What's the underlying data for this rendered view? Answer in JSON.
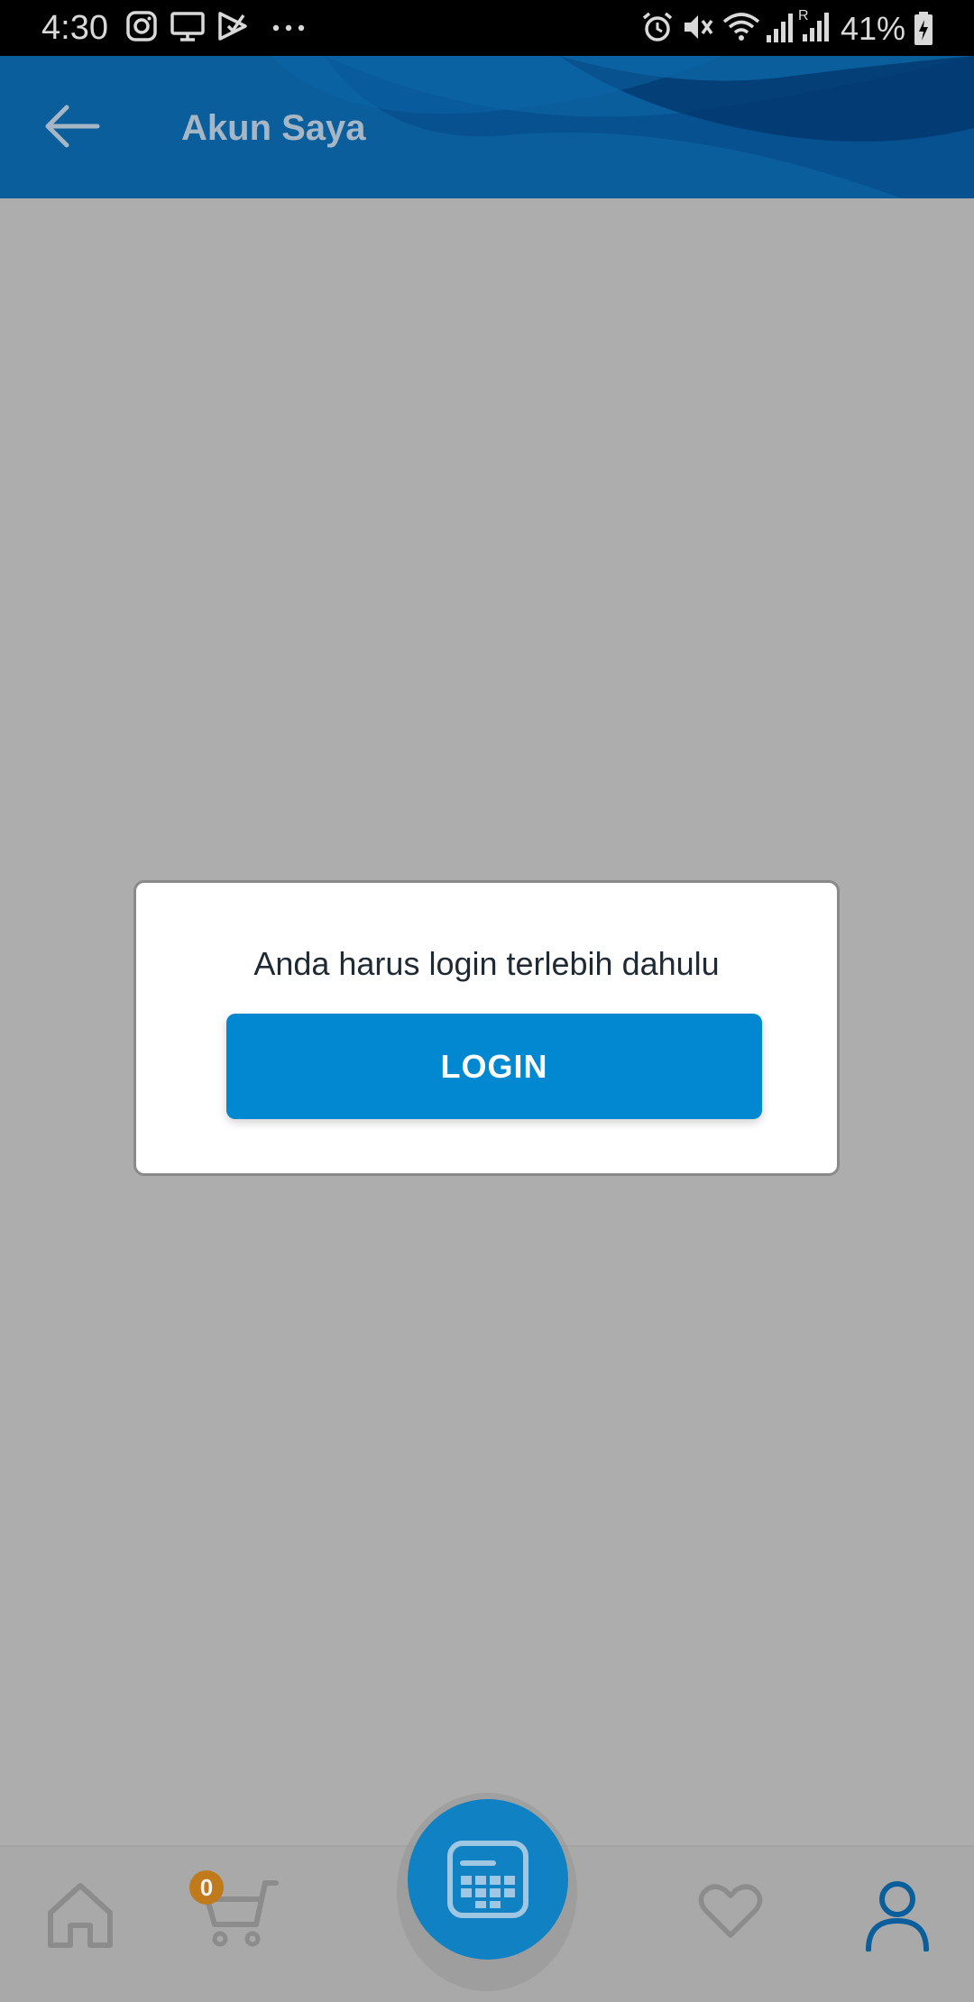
{
  "status_bar": {
    "time": "4:30",
    "battery_percent": "41%",
    "icons": [
      "instagram-icon",
      "screen-mirror-icon",
      "task-check-icon",
      "more-dots-icon",
      "alarm-icon",
      "mute-icon",
      "wifi-icon",
      "signal-icon",
      "signal-roaming-icon",
      "battery-charging-icon"
    ]
  },
  "header": {
    "title": "Akun Saya",
    "back_icon": "arrow-left-icon"
  },
  "dialog": {
    "message": "Anda harus login terlebih dahulu",
    "login_label": "LOGIN"
  },
  "bottom_nav": {
    "cart_count": "0",
    "items": [
      {
        "name": "home",
        "icon": "home-icon"
      },
      {
        "name": "cart",
        "icon": "cart-icon"
      },
      {
        "name": "center",
        "icon": "calculator-icon"
      },
      {
        "name": "wishlist",
        "icon": "heart-icon"
      },
      {
        "name": "account",
        "icon": "user-icon",
        "active": true
      }
    ]
  },
  "colors": {
    "header_bg": "#0a5e9c",
    "login_button": "#0288d1",
    "overlay": "#adadad",
    "active_nav": "#0a5e9c",
    "badge": "#c0791b"
  }
}
